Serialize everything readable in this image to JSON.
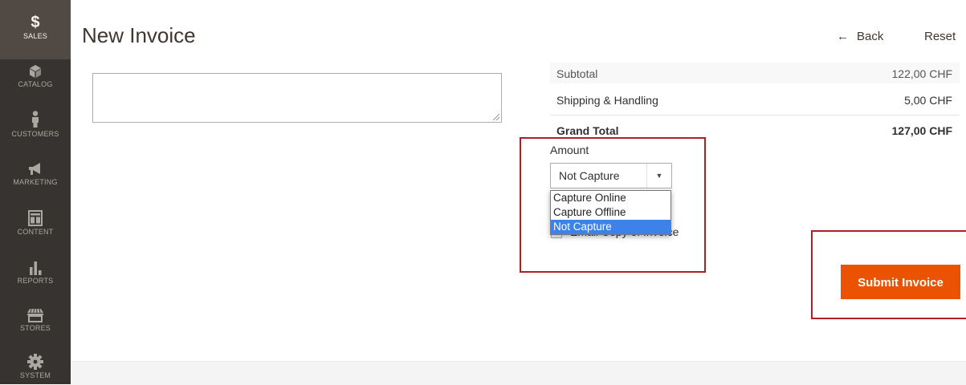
{
  "sidebar": {
    "items": [
      {
        "label": "SALES",
        "icon": "dollar-icon"
      },
      {
        "label": "CATALOG",
        "icon": "cube-icon"
      },
      {
        "label": "CUSTOMERS",
        "icon": "person-icon"
      },
      {
        "label": "MARKETING",
        "icon": "megaphone-icon"
      },
      {
        "label": "CONTENT",
        "icon": "layout-icon"
      },
      {
        "label": "REPORTS",
        "icon": "bar-chart-icon"
      },
      {
        "label": "STORES",
        "icon": "storefront-icon"
      },
      {
        "label": "SYSTEM",
        "icon": "gear-icon"
      }
    ],
    "dollar_glyph": "$"
  },
  "header": {
    "title": "New Invoice",
    "back_arrow": "←",
    "back_label": "Back",
    "reset_label": "Reset"
  },
  "totals": {
    "subtotal_label": "Subtotal",
    "subtotal_value": "122,00 CHF",
    "shipping_label": "Shipping & Handling",
    "shipping_value": "5,00 CHF",
    "grand_label": "Grand Total",
    "grand_value": "127,00 CHF"
  },
  "capture": {
    "amount_label": "Amount",
    "selected": "Not Capture",
    "caret": "▼",
    "options": [
      "Capture Online",
      "Capture Offline",
      "Not Capture"
    ],
    "email_label": "Email Copy of Invoice"
  },
  "actions": {
    "submit_label": "Submit Invoice"
  },
  "colors": {
    "sidebar_bg": "#373330",
    "sidebar_active": "#514943",
    "accent": "#eb5202",
    "highlight_red": "#b11f26",
    "option_selected": "#3c82e8"
  }
}
